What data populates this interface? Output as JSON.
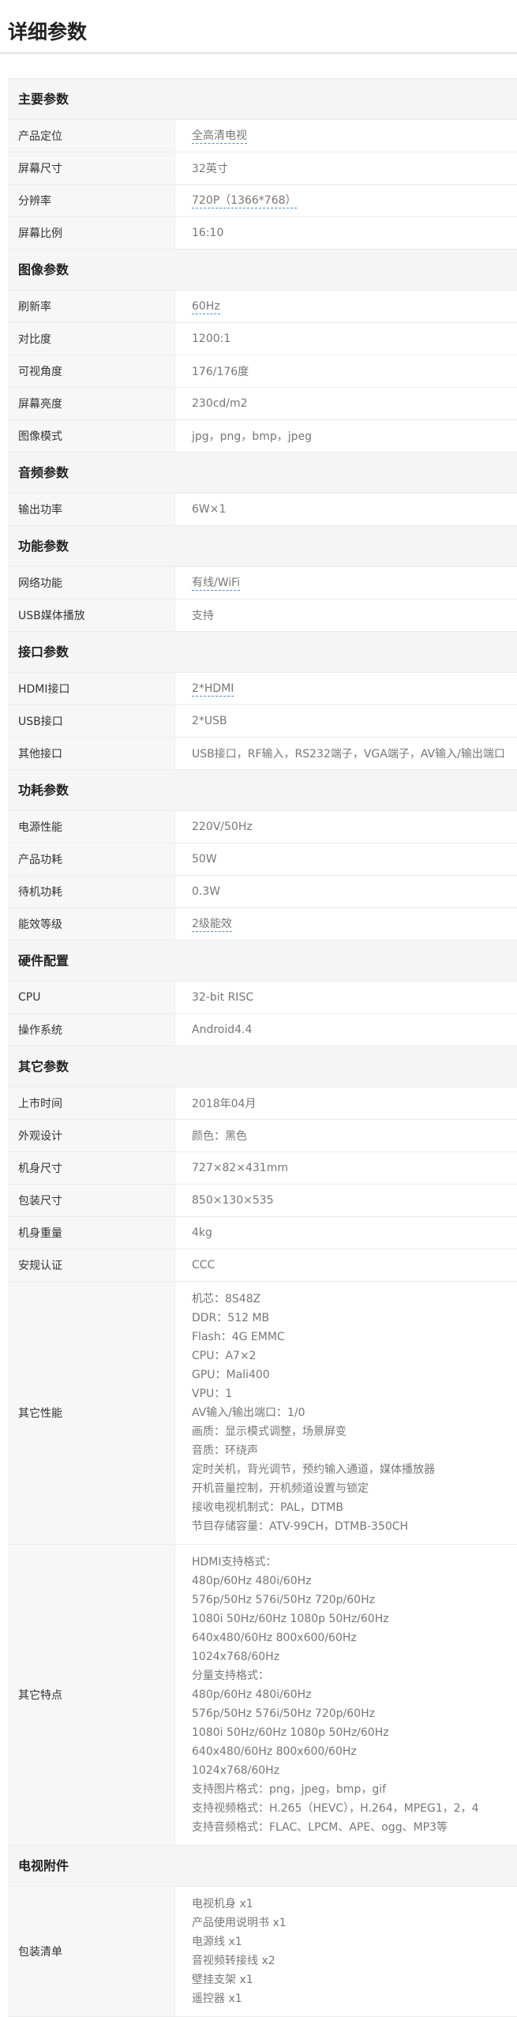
{
  "page": {
    "title": "详细参数"
  },
  "colors": {
    "link_underline": "#4a8fd9",
    "section_bg": "#f5f5f5",
    "key_bg": "#f7f7f7"
  },
  "sections": [
    {
      "title": "主要参数",
      "rows": [
        {
          "key": "产品定位",
          "value": "全高清电视",
          "link": true
        },
        {
          "key": "屏幕尺寸",
          "value": "32英寸"
        },
        {
          "key": "分辨率",
          "value": "720P（1366*768）",
          "link": true
        },
        {
          "key": "屏幕比例",
          "value": "16:10"
        }
      ]
    },
    {
      "title": "图像参数",
      "rows": [
        {
          "key": "刷新率",
          "value": "60Hz",
          "link": true
        },
        {
          "key": "对比度",
          "value": "1200:1"
        },
        {
          "key": "可视角度",
          "value": "176/176度"
        },
        {
          "key": "屏幕亮度",
          "value": "230cd/m2"
        },
        {
          "key": "图像模式",
          "value": "jpg，png，bmp，jpeg"
        }
      ]
    },
    {
      "title": "音频参数",
      "rows": [
        {
          "key": "输出功率",
          "value": "6W×1"
        }
      ]
    },
    {
      "title": "功能参数",
      "rows": [
        {
          "key": "网络功能",
          "value": "有线/WiFi",
          "link": true
        },
        {
          "key": "USB媒体播放",
          "value": "支持"
        }
      ]
    },
    {
      "title": "接口参数",
      "rows": [
        {
          "key": "HDMI接口",
          "value": "2*HDMI",
          "link": true
        },
        {
          "key": "USB接口",
          "value": "2*USB"
        },
        {
          "key": "其他接口",
          "value": "USB接口，RF输入，RS232端子，VGA端子，AV输入/输出端口"
        }
      ]
    },
    {
      "title": "功耗参数",
      "rows": [
        {
          "key": "电源性能",
          "value": "220V/50Hz"
        },
        {
          "key": "产品功耗",
          "value": "50W"
        },
        {
          "key": "待机功耗",
          "value": "0.3W"
        },
        {
          "key": "能效等级",
          "value": "2级能效",
          "link": true
        }
      ]
    },
    {
      "title": "硬件配置",
      "rows": [
        {
          "key": "CPU",
          "value": "32-bit RISC"
        },
        {
          "key": "操作系统",
          "value": "Android4.4"
        }
      ]
    },
    {
      "title": "其它参数",
      "rows": [
        {
          "key": "上市时间",
          "value": "2018年04月"
        },
        {
          "key": "外观设计",
          "value": "颜色：黑色"
        },
        {
          "key": "机身尺寸",
          "value": "727×82×431mm"
        },
        {
          "key": "包装尺寸",
          "value": "850×130×535"
        },
        {
          "key": "机身重量",
          "value": "4kg"
        },
        {
          "key": "安规认证",
          "value": "CCC"
        },
        {
          "key": "其它性能",
          "lines": [
            "机芯：8S48Z",
            "DDR：512 MB",
            "Flash：4G EMMC",
            "CPU：A7×2",
            "GPU：Mali400",
            "VPU：1",
            "AV输入/输出端口：1/0",
            "画质：显示模式调整，场景屏变",
            "音质：环绕声",
            "定时关机，背光调节，预约输入通道，媒体播放器",
            "开机音量控制，开机频道设置与锁定",
            "接收电视机制式：PAL，DTMB",
            "节目存储容量：ATV-99CH，DTMB-350CH"
          ]
        },
        {
          "key": "其它特点",
          "lines": [
            "HDMI支持格式：",
            "480p/60Hz 480i/60Hz",
            "576p/50Hz 576i/50Hz 720p/60Hz",
            "1080i 50Hz/60Hz 1080p 50Hz/60Hz",
            "640x480/60Hz 800x600/60Hz",
            "1024x768/60Hz",
            "分量支持格式：",
            "480p/60Hz 480i/60Hz",
            "576p/50Hz 576i/50Hz 720p/60Hz",
            "1080i 50Hz/60Hz 1080p 50Hz/60Hz",
            "640x480/60Hz 800x600/60Hz",
            "1024x768/60Hz",
            "支持图片格式：png，jpeg，bmp，gif",
            "支持视频格式：H.265（HEVC），H.264，MPEG1，2，4",
            "支持音频格式：FLAC、LPCM、APE、ogg、MP3等"
          ]
        }
      ]
    },
    {
      "title": "电视附件",
      "rows": [
        {
          "key": "包装清单",
          "lines": [
            "电视机身 x1",
            "产品使用说明书 x1",
            "电源线 x1",
            "音视频转接线 x2",
            "壁挂支架 x1",
            "遥控器 x1"
          ]
        }
      ]
    }
  ]
}
